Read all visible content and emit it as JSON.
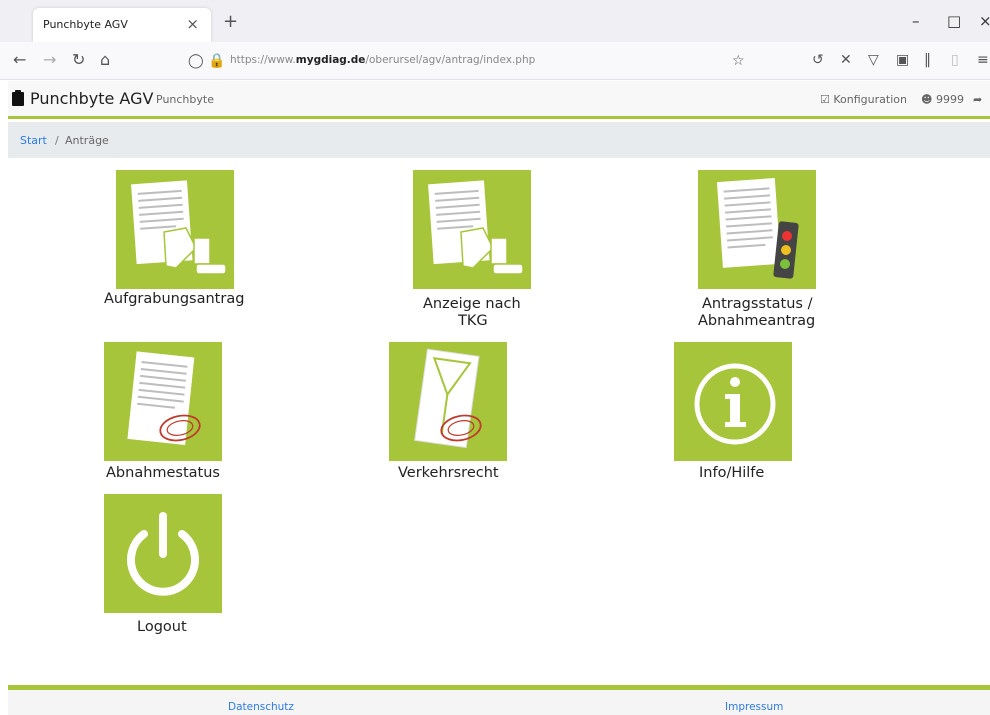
{
  "browser": {
    "tab_title": "Punchbyte AGV",
    "tab_close": "×",
    "new_tab": "+",
    "url_prefix": "https://www.",
    "url_domain": "mygdiag.de",
    "url_path": "/oberursel/agv/antrag/index.php"
  },
  "header": {
    "brand": "Punchbyte AGV",
    "subbrand": "Punchbyte",
    "config_label": "Konfiguration",
    "user_id": "9999"
  },
  "breadcrumb": {
    "start": "Start",
    "separator": "/",
    "current": "Anträge"
  },
  "tiles": [
    {
      "label": "Aufgrabungsantrag",
      "icon": "document-excavator-icon"
    },
    {
      "label_line1": "Anzeige nach",
      "label_line2": "TKG",
      "icon": "document-excavator-icon"
    },
    {
      "label_line1": "Antragsstatus /",
      "label_line2": "Abnahmeantrag",
      "icon": "document-traffic-light-icon"
    },
    {
      "label": "Abnahmestatus",
      "icon": "document-stamp-icon"
    },
    {
      "label": "Verkehrsrecht",
      "icon": "sign-stamp-icon"
    },
    {
      "label": "Info/Hilfe",
      "icon": "info-icon"
    },
    {
      "label": "Logout",
      "icon": "power-icon"
    }
  ],
  "footer": {
    "privacy": "Datenschutz",
    "imprint": "Impressum"
  },
  "colors": {
    "accent": "#a6c53a",
    "link": "#2c7be5"
  }
}
